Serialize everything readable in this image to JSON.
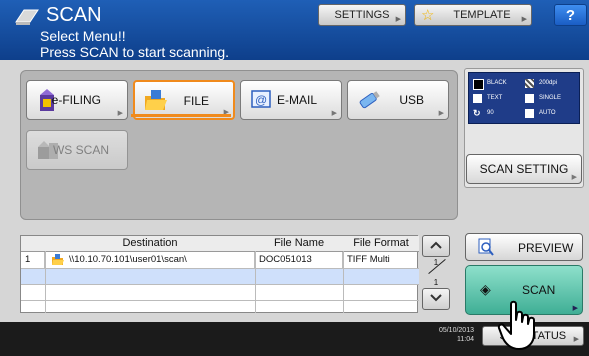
{
  "header": {
    "title": "SCAN",
    "message_line1": "Select Menu!!",
    "message_line2": "Press SCAN to start scanning.",
    "settings_label": "SETTINGS",
    "template_label": "TEMPLATE",
    "help_label": "?"
  },
  "destinations": {
    "efiling": "e-FILING",
    "file": "FILE",
    "email": "E-MAIL",
    "usb": "USB",
    "wsscan": "WS SCAN"
  },
  "settings_summary": {
    "color": "BLACK",
    "resolution": "200dpi",
    "mode": "TEXT",
    "sides": "SINGLE",
    "rotation": "90",
    "size": "AUTO",
    "button_label": "SCAN SETTING"
  },
  "table": {
    "headers": {
      "destination": "Destination",
      "file_name": "File Name",
      "file_format": "File Format"
    },
    "rows": [
      {
        "num": "1",
        "destination": "\\\\10.10.70.101\\user01\\scan\\",
        "file_name": "DOC051013",
        "file_format": "TIFF Multi"
      }
    ]
  },
  "pager": {
    "current": "1",
    "total": "1"
  },
  "actions": {
    "preview_label": "PREVIEW",
    "scan_label": "SCAN"
  },
  "footer": {
    "date": "05/10/2013",
    "time": "11:04",
    "job_status_label": "JOB STATUS"
  },
  "colors": {
    "header_blue": "#1f5fb6",
    "file_accent": "#f08a1c",
    "scan_green": "#5cc4aa",
    "selected_row": "#cfe0fb"
  }
}
